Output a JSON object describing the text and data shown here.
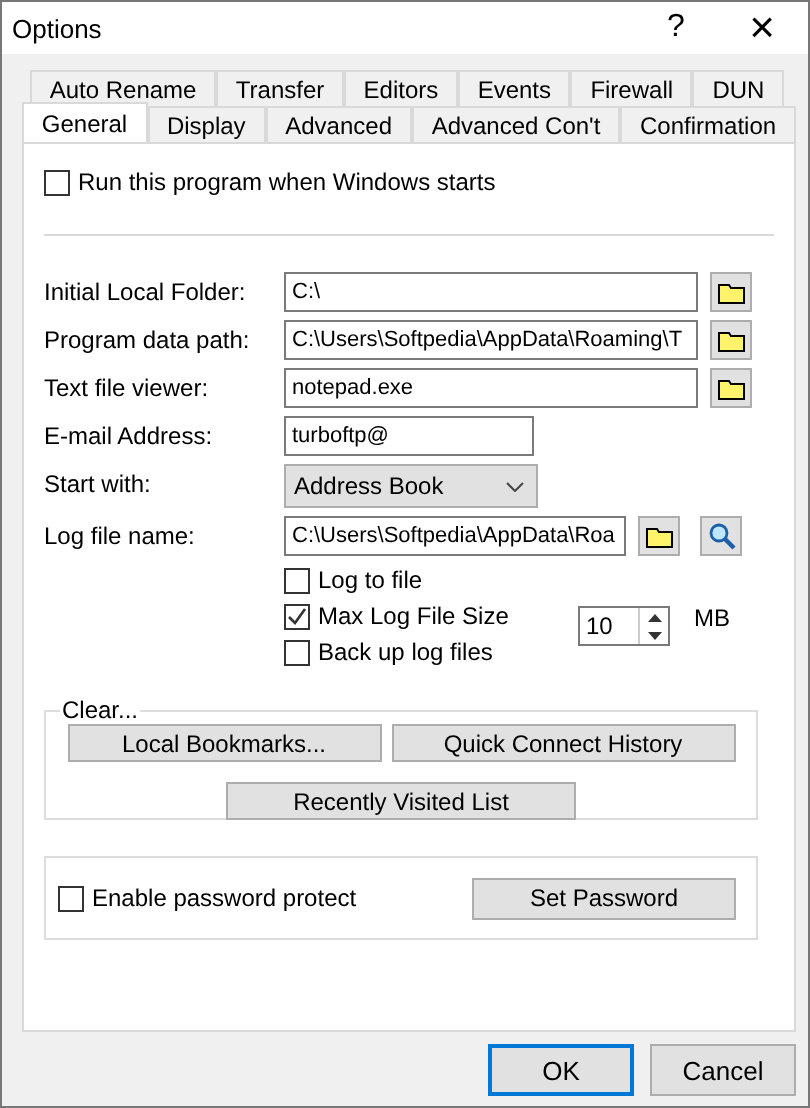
{
  "window": {
    "title": "Options",
    "help": "?",
    "close": "×"
  },
  "tab_rows": [
    [
      {
        "label": "Auto Rename",
        "selected": false
      },
      {
        "label": "Transfer",
        "selected": false
      },
      {
        "label": "Editors",
        "selected": false
      },
      {
        "label": "Events",
        "selected": false
      },
      {
        "label": "Firewall",
        "selected": false
      },
      {
        "label": "DUN",
        "selected": false
      }
    ],
    [
      {
        "label": "General",
        "selected": true
      },
      {
        "label": "Display",
        "selected": false
      },
      {
        "label": "Advanced",
        "selected": false
      },
      {
        "label": "Advanced Con't",
        "selected": false
      },
      {
        "label": "Confirmation",
        "selected": false
      }
    ]
  ],
  "startup": {
    "label": "Run this program when Windows starts",
    "checked": false
  },
  "fields": [
    {
      "kind": "folder",
      "label": "Initial Local Folder:",
      "value": "C:\\"
    },
    {
      "kind": "folder",
      "label": "Program data path:",
      "value": "C:\\Users\\Softpedia\\AppData\\Roaming\\T"
    },
    {
      "kind": "folder",
      "label": "Text file viewer:",
      "value": "notepad.exe"
    },
    {
      "kind": "text",
      "label": "E-mail Address:",
      "value": "turboftp@"
    },
    {
      "kind": "select",
      "label": "Start with:",
      "value": "Address Book"
    },
    {
      "kind": "log",
      "label": "Log file name:",
      "value": "C:\\Users\\Softpedia\\AppData\\Roa"
    }
  ],
  "log_options": [
    {
      "kind": "check",
      "label": "Log to file",
      "checked": false
    },
    {
      "kind": "size",
      "label": "Max Log File Size",
      "checked": true,
      "value": "10",
      "unit": "MB"
    },
    {
      "kind": "check",
      "label": "Back up log files",
      "checked": false
    }
  ],
  "clear_group": {
    "title": "Clear...",
    "buttons": [
      "Local Bookmarks...",
      "Quick Connect History",
      "Recently Visited List"
    ]
  },
  "password": {
    "label": "Enable password protect",
    "checked": false,
    "button": "Set Password"
  },
  "buttons": [
    {
      "label": "OK",
      "default": true
    },
    {
      "label": "Cancel",
      "default": false
    }
  ]
}
